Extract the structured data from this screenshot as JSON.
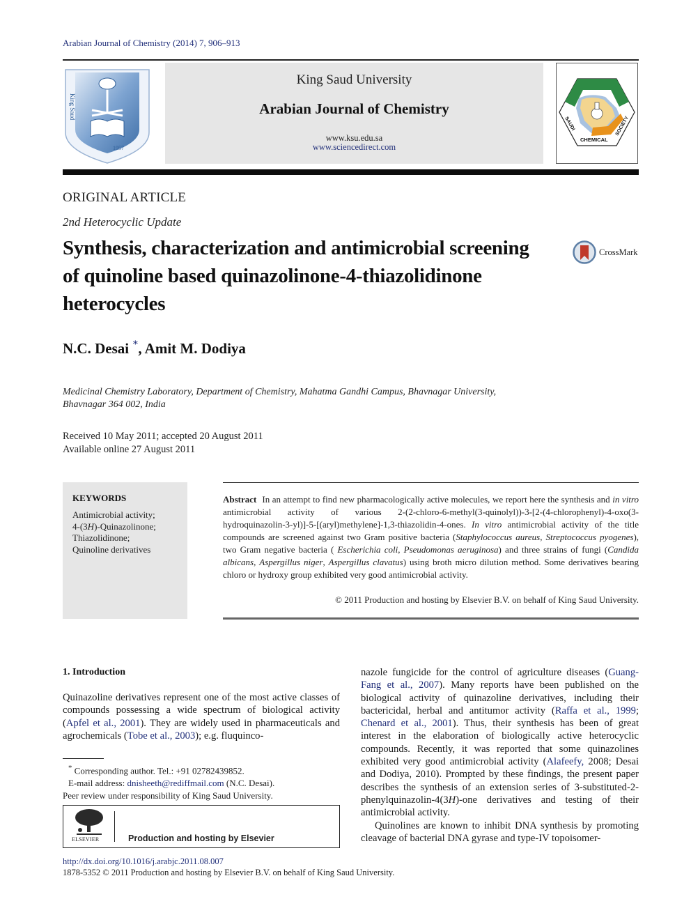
{
  "journal_ref": "Arabian Journal of Chemistry (2014) 7, 906–913",
  "header": {
    "university": "King Saud University",
    "journal_name": "Arabian Journal of Chemistry",
    "url_1": "www.ksu.edu.sa",
    "url_2": "www.sciencedirect.com",
    "left_logo": "ksu-logo",
    "right_logo": "saudi-chemical-society-logo",
    "right_logo_text": "CHEMICAL"
  },
  "article": {
    "type": "ORIGINAL ARTICLE",
    "series": "2nd Heterocyclic Update",
    "title": "Synthesis, characterization and antimicrobial screening of quinoline based quinazolinone-4-thiazolidinone heterocycles",
    "crossmark_label": "CrossMark",
    "authors": [
      {
        "name": "N.C. Desai",
        "mark": "*"
      },
      {
        "name": "Amit M. Dodiya",
        "mark": ""
      }
    ],
    "author_separator": ", ",
    "affiliation_line1": "Medicinal Chemistry Laboratory, Department of Chemistry, Mahatma Gandhi Campus, Bhavnagar University,",
    "affiliation_line2": "Bhavnagar 364 002, India",
    "received": "Received 10 May 2011; accepted 20 August 2011",
    "available": "Available online 27 August 2011"
  },
  "keywords": {
    "heading": "KEYWORDS",
    "items": [
      "Antimicrobial activity;",
      "4-(3H)-Quinazolinone;",
      "Thiazolidinone;",
      "Quinoline derivatives"
    ]
  },
  "abstract": {
    "label": "Abstract",
    "seg1": "In an attempt to find new pharmacologically active molecules, we report here the synthesis and ",
    "seg2_italic": "in vitro",
    "seg3": " antimicrobial activity of various 2-(2-chloro-6-methyl(3-quinolyl))-3-[2-(4-chlorophenyl)-4-oxo(3-hydroquinazolin-3-yl)]-5-[(aryl)methylene]-1,3-thiazolidin-4-ones. ",
    "seg4_italic": "In vitro",
    "seg5": " antimicrobial activity of the title compounds are screened against two Gram positive bacteria (",
    "seg6_italic": "Staphylococcus aureus",
    "seg7": ", ",
    "seg8_italic": "Streptococcus pyogenes",
    "seg9": "), two Gram negative bacteria ( ",
    "seg10_italic": "Escherichia coli",
    "seg11": ", ",
    "seg12_italic": "Pseudomonas aeruginosa",
    "seg13": ") and three strains of fungi (",
    "seg14_italic": "Candida albicans",
    "seg15": ", ",
    "seg16_italic": "Aspergillus niger",
    "seg17": ", ",
    "seg18_italic": "Aspergillus clavatus",
    "seg19": ") using broth micro dilution method. Some derivatives bearing chloro or hydroxy group exhibited very good antimicrobial activity.",
    "copyright": "© 2011 Production and hosting by Elsevier B.V. on behalf of King Saud University."
  },
  "introduction": {
    "heading": "1. Introduction",
    "left": {
      "t1": "Quinazoline derivatives represent one of the most active classes of compounds possessing a wide spectrum of biological activity (",
      "c1": "Apfel et al., 2001",
      "t2": "). They are widely used in pharmaceuticals and agrochemicals (",
      "c2": "Tobe et al., 2003",
      "t3": "); e.g. fluquinco-"
    },
    "right": {
      "t1": "nazole fungicide for the control of agriculture diseases (",
      "c1": "Guang-Fang et al., 2007",
      "t2": "). Many reports have been published on the biological activity of quinazoline derivatives, including their bactericidal, herbal and antitumor activity (",
      "c2": "Raffa et al., 1999",
      "t3": "; ",
      "c3": "Chenard et al., 2001",
      "t4": "). Thus, their synthesis has been of great interest in the elaboration of biologically active heterocyclic compounds. Recently, it was reported that some quinazolines exhibited very good antimicrobial activity (",
      "c4": "Alafeefy,",
      "t5": " 2008; Desai and Dodiya, 2010). Prompted by these findings, the present paper describes the synthesis of an extension series of 3-substituted-2-phenylquinazolin-4(3",
      "t5_italic": "H",
      "t6": ")-one derivatives and testing of their antimicrobial activity.",
      "p2": "Quinolines are known to inhibit DNA synthesis by promoting cleavage of bacterial DNA gyrase and type-IV topoisomer-"
    }
  },
  "footnotes": {
    "star": "*",
    "corresponding": "Corresponding author. Tel.: +91 02782439852.",
    "email_label": "E-mail address: ",
    "email": "dnisheeth@rediffmail.com",
    "email_suffix": " (N.C. Desai).",
    "peer_review": "Peer review under responsibility of King Saud University."
  },
  "elsevier_box": {
    "wordmark": "ELSEVIER",
    "text": "Production and hosting by Elsevier"
  },
  "footer": {
    "doi": "http://dx.doi.org/10.1016/j.arabjc.2011.08.007",
    "copyright": "1878-5352 © 2011 Production and hosting by Elsevier B.V. on behalf of King Saud University."
  },
  "colors": {
    "link": "#22307a",
    "header_gray": "#e6e6e6",
    "ksu_blue": "#6f97c6",
    "scs_green": "#2e8b45",
    "scs_orange": "#e8921c",
    "crossmark_red": "#c0392b"
  }
}
